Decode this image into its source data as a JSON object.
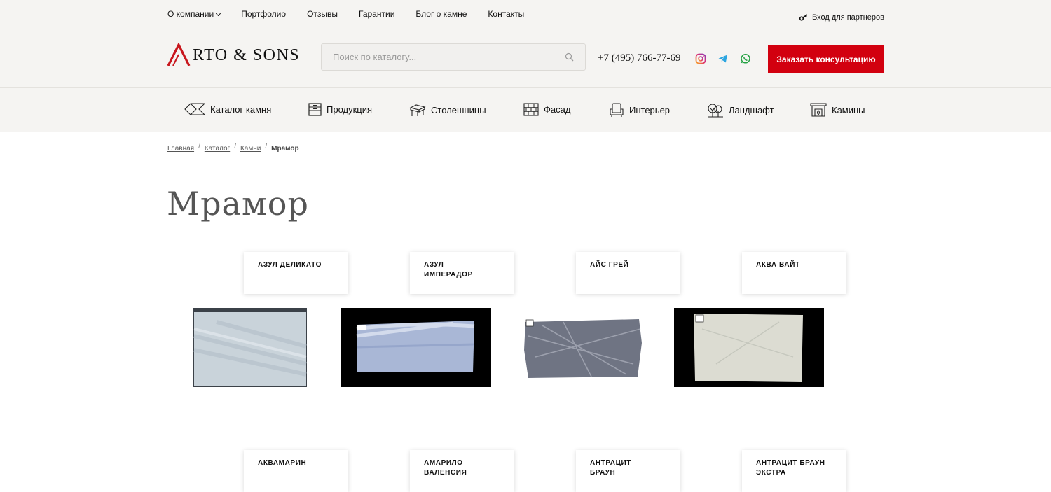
{
  "topnav": {
    "items": [
      "О компании",
      "Портфолио",
      "Отзывы",
      "Гарантии",
      "Блог о камне",
      "Контакты"
    ],
    "partners": "Вход для партнеров"
  },
  "header": {
    "logo_text": "RTO & SONS",
    "search_placeholder": "Поиск по каталогу...",
    "phone": "+7 (495) 766-77-69",
    "cta": "Заказать консультацию"
  },
  "catnav": {
    "items": [
      "Каталог камня",
      "Продукция",
      "Столешницы",
      "Фасад",
      "Интерьер",
      "Ландшафт",
      "Камины"
    ]
  },
  "breadcrumbs": [
    "Главная",
    "Каталог",
    "Камни",
    "Мрамор"
  ],
  "page_title": "Мрамор",
  "products": {
    "row1": [
      {
        "name": "АЗУЛ ДЕЛИКАТО",
        "slab_bg": "#c9d3da"
      },
      {
        "name": "АЗУЛ ИМПЕРАДОР",
        "slab_bg": "#a9b7d6"
      },
      {
        "name": "АЙС ГРЕЙ",
        "slab_bg": "#6f7483"
      },
      {
        "name": "АКВА ВАЙТ",
        "slab_bg": "#dcdcd2"
      }
    ],
    "row2": [
      {
        "name": "АКВАМАРИН"
      },
      {
        "name": "АМАРИЛО ВАЛЕНСИЯ"
      },
      {
        "name": "АНТРАЦИТ БРАУН"
      },
      {
        "name": "АНТРАЦИТ БРАУН ЭКСТРА"
      }
    ]
  },
  "colors": {
    "accent": "#d2000f",
    "header_bg": "#f5f4f2"
  }
}
